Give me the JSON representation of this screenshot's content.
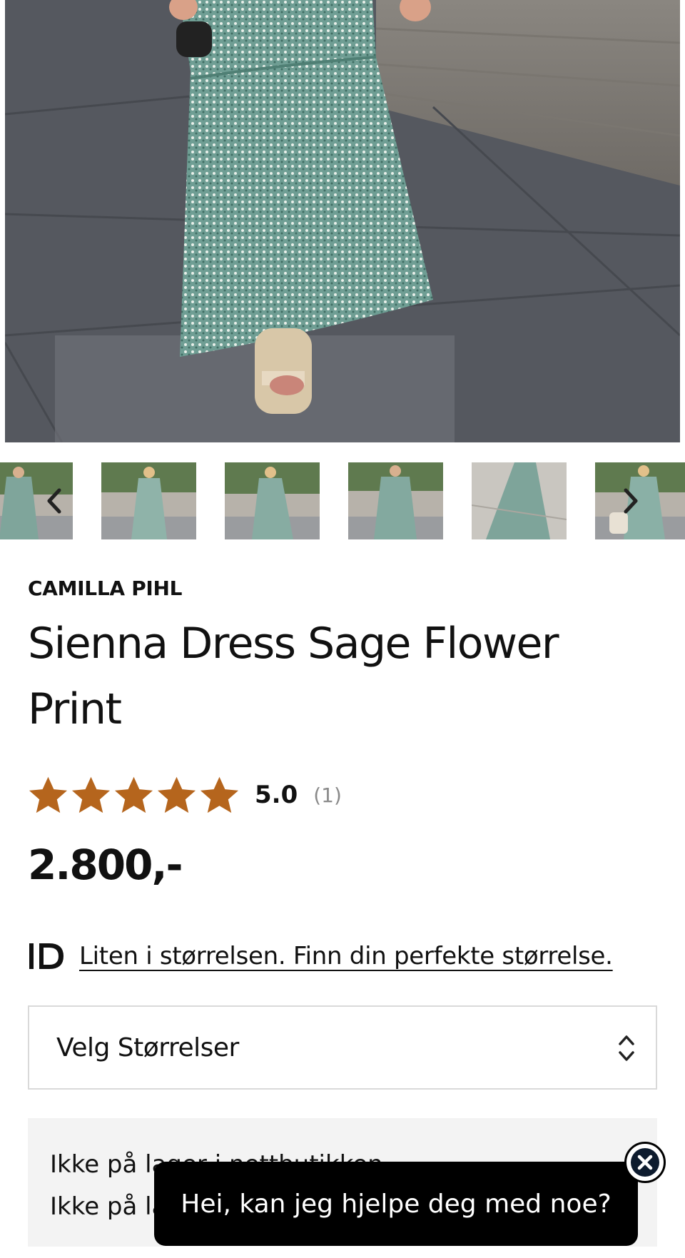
{
  "gallery": {
    "hero_alt": "Sienna Dress Sage Flower Print",
    "thumbnails": [
      "thumb-1",
      "thumb-2",
      "thumb-3",
      "thumb-4",
      "thumb-5",
      "thumb-6"
    ],
    "prev_icon": "chevron-left-icon",
    "next_icon": "chevron-right-icon"
  },
  "product": {
    "brand": "CAMILLA PIHL",
    "name": "Sienna Dress Sage Flower Print",
    "rating": {
      "stars": 5,
      "value": "5.0",
      "count": "(1)",
      "star_color": "#b5651d"
    },
    "price": "2.800,-"
  },
  "size_guide": {
    "icon": "id-logo-icon",
    "link_text": "Liten i størrelsen. Finn din perfekte størrelse."
  },
  "size_select": {
    "label": "Velg Størrelser",
    "icon": "chevron-up-down-icon"
  },
  "stock": {
    "line1": "Ikke på lager i nettbutikken",
    "line2": "Ikke på la"
  },
  "chat": {
    "message": "Hei, kan jeg hjelpe deg med noe?",
    "close_icon": "close-icon"
  }
}
